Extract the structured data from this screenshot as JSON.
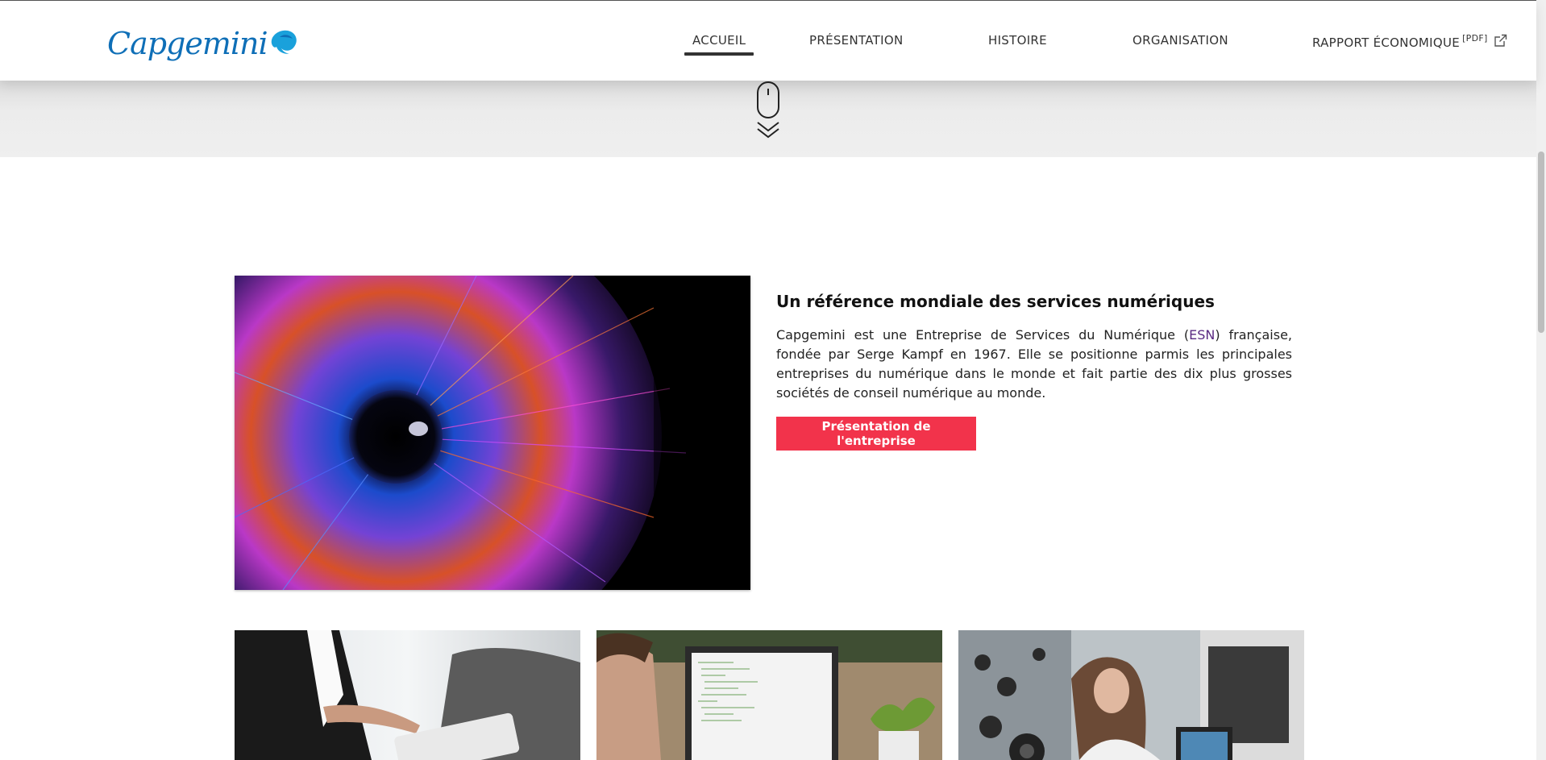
{
  "header": {
    "logo_text": "Capgemini",
    "nav": [
      {
        "label": "ACCUEIL",
        "active": true
      },
      {
        "label": "PRÉSENTATION",
        "active": false
      },
      {
        "label": "HISTOIRE",
        "active": false
      },
      {
        "label": "ORGANISATION",
        "active": false
      },
      {
        "label": "RAPPORT ÉCONOMIQUE",
        "sup": "[PDF]",
        "active": false
      }
    ]
  },
  "intro": {
    "title": "Un référence mondiale des services numériques",
    "text_before": "Capgemini est une Entreprise de Services du Numérique (",
    "link_label": "ESN",
    "text_after": ") française, fondée par Serge Kampf en 1967. Elle se positionne parmis les principales entreprises du numérique dans le monde et fait partie des dix plus grosses sociétés de conseil numérique au monde.",
    "button_label": "Présentation de l'entreprise"
  },
  "colors": {
    "brand_blue": "#0f6fb7",
    "accent_red": "#f2334b",
    "link_purple": "#5a2a82"
  },
  "icons": [
    "spade-logo-icon",
    "external-link-icon",
    "mouse-icon",
    "double-chevron-down-icon"
  ]
}
